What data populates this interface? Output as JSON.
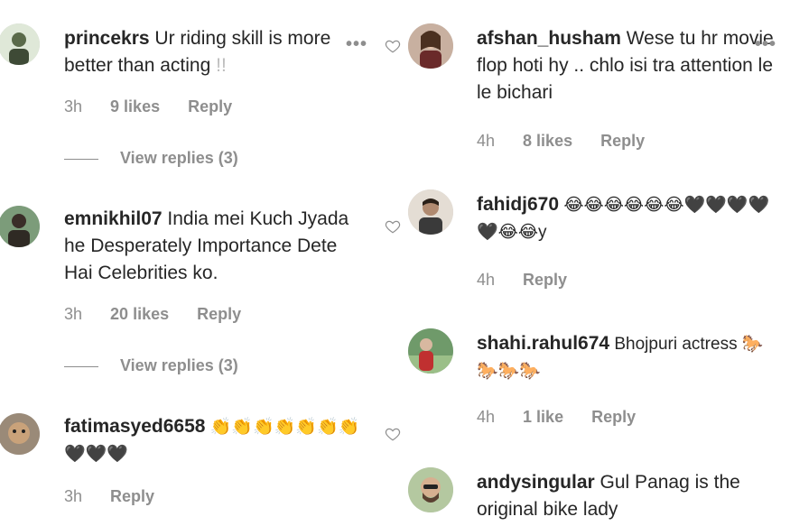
{
  "left": [
    {
      "username": "princekrs",
      "text": "Ur riding skill is more better than acting",
      "text_suffix": "!!",
      "time": "3h",
      "likes": "9 likes",
      "reply": "Reply",
      "view_replies": "View replies (3)",
      "avatar_color": "#c8d8c0"
    },
    {
      "username": "emnikhil07",
      "text": "India mei Kuch Jyada he Desperately Importance Dete Hai Celebrities ko.",
      "time": "3h",
      "likes": "20 likes",
      "reply": "Reply",
      "view_replies": "View replies (3)",
      "avatar_color": "#6b8f6a"
    },
    {
      "username": "fatimasyed6658",
      "text": "👏👏👏👏👏👏👏 🖤🖤🖤",
      "time": "3h",
      "reply": "Reply",
      "avatar_color": "#8b7a6a"
    }
  ],
  "right": [
    {
      "username": "afshan_husham",
      "text": "Wese tu hr movie flop hoti hy .. chlo isi tra attention le le bichari",
      "time": "4h",
      "likes": "8 likes",
      "reply": "Reply",
      "avatar_color": "#b8a090"
    },
    {
      "username": "fahidj670",
      "text": "😂😂😂😂😂😂🖤🖤🖤🖤 🖤😂😂y",
      "time": "4h",
      "reply": "Reply",
      "avatar_color": "#d8cfc4"
    },
    {
      "username": "shahi.rahul674",
      "text": "Bhojpuri actress 🐎🐎🐎🐎",
      "time": "4h",
      "likes": "1 like",
      "reply": "Reply",
      "avatar_color": "#7fa07a"
    },
    {
      "username": "andysingular",
      "text": "Gul Panag is the original bike lady",
      "avatar_color": "#a4b890"
    }
  ],
  "icons": {
    "more": "more-options-icon",
    "heart": "heart-outline-icon"
  },
  "colors": {
    "text": "#262626",
    "muted": "#8e8e8e",
    "background": "#ffffff"
  }
}
